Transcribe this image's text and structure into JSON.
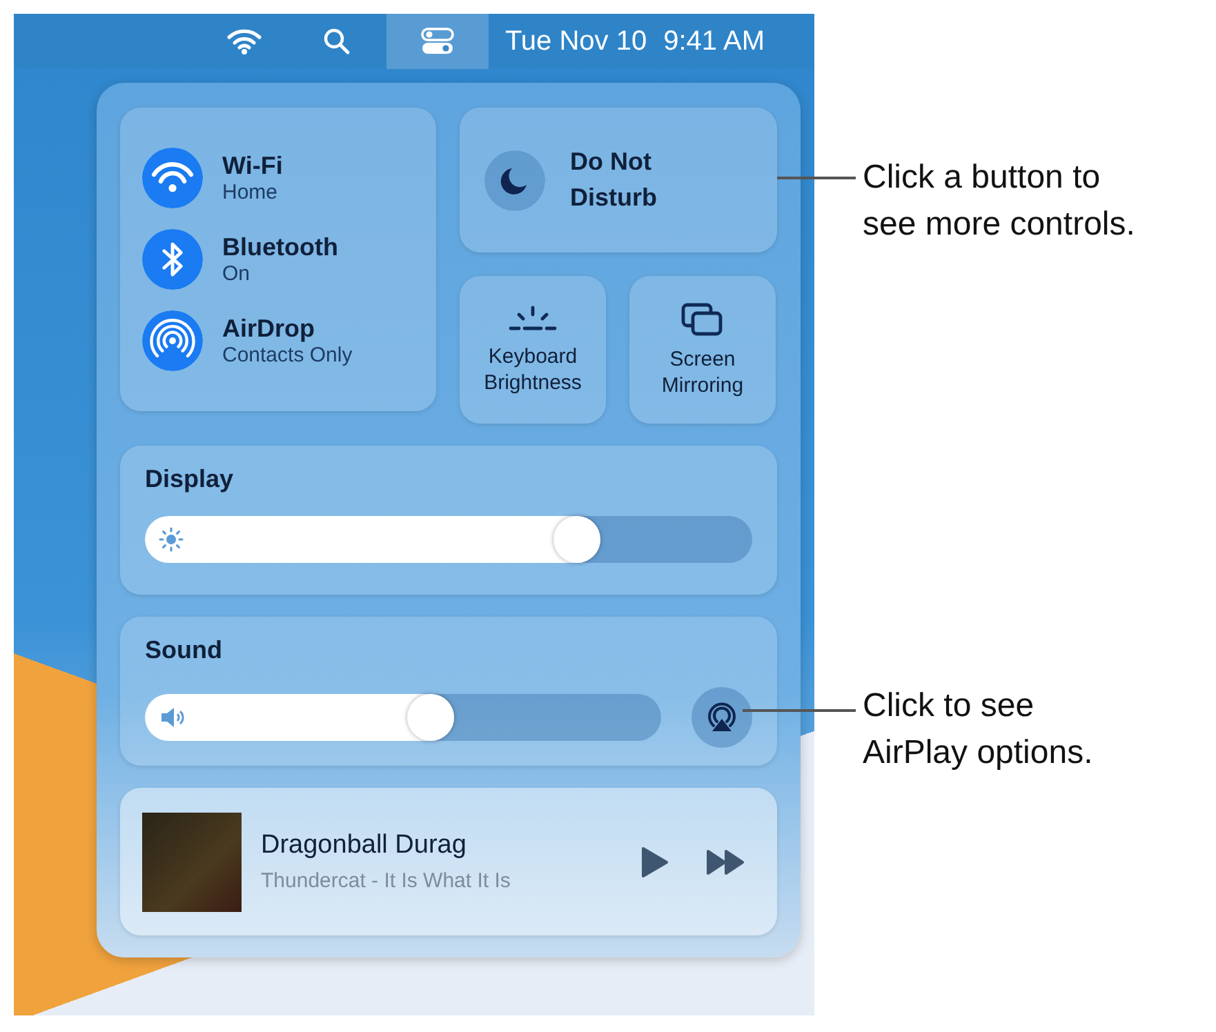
{
  "menu_bar": {
    "items": [
      {
        "kind": "wifi",
        "selected": false
      },
      {
        "kind": "search",
        "selected": false
      },
      {
        "kind": "control-center",
        "selected": true
      }
    ],
    "date": "Tue Nov 10",
    "time": "9:41 AM"
  },
  "connectivity": [
    {
      "kind": "wifi",
      "name": "Wi-Fi",
      "status": "Home",
      "on": true
    },
    {
      "kind": "bluetooth",
      "name": "Bluetooth",
      "status": "On",
      "on": true
    },
    {
      "kind": "airdrop",
      "name": "AirDrop",
      "status": "Contacts Only",
      "on": true
    }
  ],
  "do_not_disturb": {
    "label": "Do Not Disturb",
    "on": false
  },
  "small_buttons": [
    {
      "kind": "keyboard-brightness",
      "label": "Keyboard Brightness"
    },
    {
      "kind": "screen-mirroring",
      "label": "Screen Mirroring"
    }
  ],
  "display": {
    "label": "Display",
    "level": 0.75
  },
  "sound": {
    "label": "Sound",
    "level": 0.6
  },
  "now_playing": {
    "title": "Dragonball Durag",
    "subtitle": "Thundercat - It Is What It Is"
  },
  "callouts": [
    {
      "text": "Click a button to see more controls."
    },
    {
      "text": "Click to see AirPlay options."
    }
  ]
}
